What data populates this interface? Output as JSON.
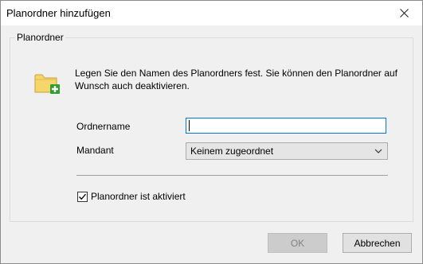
{
  "window": {
    "title": "Planordner hinzufügen",
    "close_icon": "close-icon"
  },
  "group": {
    "label": "Planordner",
    "icon": "folder-add-icon",
    "description": "Legen Sie den Namen des Planordners fest. Sie können den Planordner auf Wunsch auch deaktivieren."
  },
  "form": {
    "ordnername_label": "Ordnername",
    "ordnername_value": "",
    "mandant_label": "Mandant",
    "mandant_selected": "Keinem zugeordnet",
    "active_checkbox_label": "Planordner ist aktiviert",
    "active_checked": true
  },
  "buttons": {
    "ok_label": "OK",
    "ok_enabled": false,
    "cancel_label": "Abbrechen"
  },
  "colors": {
    "accent": "#0078d7",
    "folder_yellow": "#f5d66b",
    "plus_green": "#2e9e2e"
  }
}
